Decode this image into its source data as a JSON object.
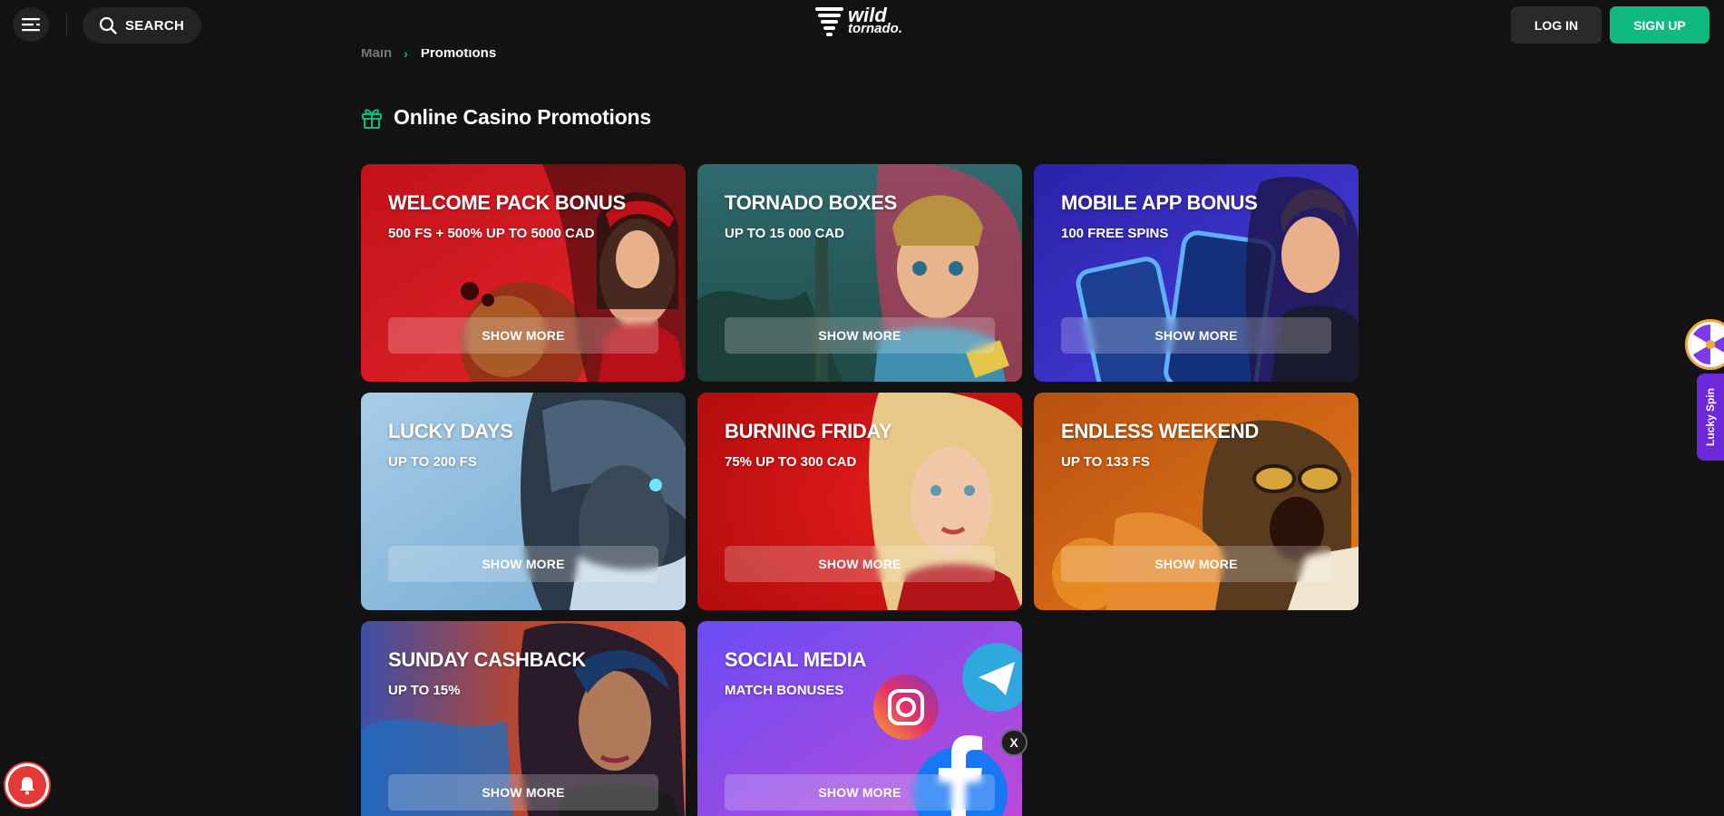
{
  "header": {
    "search_label": "SEARCH",
    "logo_line1": "wild",
    "logo_line2": "tornado.",
    "login_label": "LOG IN",
    "signup_label": "SIGN UP"
  },
  "breadcrumb": {
    "main": "Main",
    "separator": "›",
    "current": "Promotions"
  },
  "page": {
    "title": "Online Casino Promotions"
  },
  "colors": {
    "background": "#121212",
    "accent": "#10b981",
    "lucky_spin": "#6d28d9",
    "bell": "#e53935"
  },
  "promos": [
    {
      "title": "WELCOME PACK BONUS",
      "subtitle": "500 FS + 500% UP TO 5000 CAD",
      "button": "SHOW MORE"
    },
    {
      "title": "TORNADO BOXES",
      "subtitle": "UP TO 15 000 CAD",
      "button": "SHOW MORE"
    },
    {
      "title": "MOBILE APP BONUS",
      "subtitle": "100 FREE SPINS",
      "button": "SHOW MORE"
    },
    {
      "title": "LUCKY DAYS",
      "subtitle": "UP TO 200 FS",
      "button": "SHOW MORE"
    },
    {
      "title": "BURNING FRIDAY",
      "subtitle": "75% UP TO 300 CAD",
      "button": "SHOW MORE"
    },
    {
      "title": "ENDLESS WEEKEND",
      "subtitle": "UP TO 133 FS",
      "button": "SHOW MORE"
    },
    {
      "title": "SUNDAY CASHBACK",
      "subtitle": "UP TO 15%",
      "button": "SHOW MORE"
    },
    {
      "title": "SOCIAL MEDIA",
      "subtitle": "MATCH BONUSES",
      "button": "SHOW MORE"
    }
  ],
  "lucky_spin": {
    "label": "Lucky Spin"
  },
  "social_badge": "X"
}
